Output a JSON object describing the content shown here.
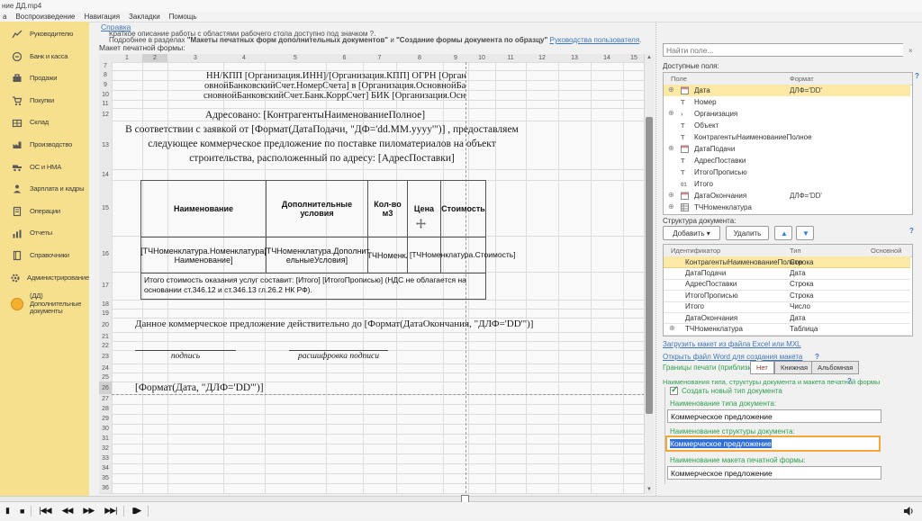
{
  "window": {
    "title": "ние ДД.mp4",
    "menus": [
      "а",
      "Воспроизведение",
      "Навигация",
      "Закладки",
      "Помощь"
    ]
  },
  "sidebar": {
    "items": [
      {
        "icon": "chart-icon",
        "label": "Руководителю"
      },
      {
        "icon": "bank-icon",
        "label": "Банк и касса"
      },
      {
        "icon": "sales-icon",
        "label": "Продажи"
      },
      {
        "icon": "cart-icon",
        "label": "Покупки"
      },
      {
        "icon": "warehouse-icon",
        "label": "Склад"
      },
      {
        "icon": "factory-icon",
        "label": "Производство"
      },
      {
        "icon": "assets-icon",
        "label": "ОС и НМА"
      },
      {
        "icon": "people-icon",
        "label": "Зарплата и кадры"
      },
      {
        "icon": "operations-icon",
        "label": "Операции"
      },
      {
        "icon": "reports-icon",
        "label": "Отчеты"
      },
      {
        "icon": "books-icon",
        "label": "Справочники"
      },
      {
        "icon": "gear-icon",
        "label": "Администрирование"
      },
      {
        "icon": "dd-icon",
        "label": "(ДД) Дополнительные документы"
      }
    ]
  },
  "help": {
    "link": "Справка",
    "line1": "Краткое описание работы с областями рабочего стола доступно под значком ?.",
    "line2_prefix": "Подробнее в разделах ",
    "line2_bold1": "\"Макеты печатных форм дополнительных документов\"",
    "line2_mid": " и ",
    "line2_bold2": "\"Создание формы документа по образцу\"",
    "line2_link": "Руководства пользователя",
    "line2_suffix": ".",
    "layout_label": "Макет печатной формы:"
  },
  "grid": {
    "col_numbers": [
      1,
      2,
      3,
      4,
      5,
      6,
      7,
      8,
      9,
      10,
      11,
      12,
      13,
      14,
      15
    ],
    "row_numbers": [
      7,
      8,
      9,
      10,
      11,
      12,
      13,
      14,
      15,
      16,
      17,
      18,
      19,
      20,
      21,
      22,
      23,
      24,
      25,
      26,
      27,
      28,
      29,
      30,
      31,
      32,
      33,
      34,
      35,
      36
    ],
    "selected_column": 2,
    "selected_row": 26
  },
  "template": {
    "row8": "НН/КПП [Организация.ИНН]/[Организация.КПП] ОГРН [Организация.ОГРН",
    "row9": "овнойБанковскийСчет.НомерСчета] в [Организация.ОсновнойБанковскийСч",
    "row10": "сновнойБанковскийСчет.Банк.КоррСчет] БИК [Организация.ОсновнойБанко",
    "row12": "Адресовано: [КонтрагентыНаименованиеПолное]",
    "row13": "В соответствии с заявкой от [Формат(ДатаПодачи, \"ДФ='dd.MM.yyyy'\")] , предоставляем\nследующее коммерческое предложение по поставке пиломатериалов на объект\nстроительства, расположенный по адресу: [АдресПоставки]",
    "table": {
      "headers": [
        "Наименование",
        "Дополнительные условия",
        "Кол-во м3",
        "Цена",
        "Стоимость"
      ],
      "row": [
        "[ТЧНоменклатура.Номенклатура.\nНаименование]",
        "[ТЧНоменклатура.Дополнит\nельныеУсловия]",
        "[ТЧНоменкл",
        "[ТЧНоменклатура.Стоимость]"
      ]
    },
    "totals": "Итого стоимость оказания услуг составит: [Итого] [ИтогоПрописью] (НДС не облагается на\nосновании ст.346.12 и ст.346.13 гл.26.2 НК РФ).",
    "row20": "Данное коммерческое предложение действительно до [Формат(ДатаОкончания, \"ДЛФ='DD'\")]",
    "sig1": "подпись",
    "sig2": "расшифровка подписи",
    "row26": "[Формат(Дата, \"ДЛФ='DD'\")]"
  },
  "fields_panel": {
    "search_placeholder": "Найти поле...",
    "clear_label": "×",
    "label": "Доступные поля:",
    "help_q": "?",
    "columns": [
      "Поле",
      "Формат"
    ],
    "rows": [
      {
        "name": "Дата",
        "icon": "calendar",
        "expand": true,
        "format": "ДЛФ='DD'",
        "selected": true
      },
      {
        "name": "Номер",
        "icon": "text"
      },
      {
        "name": "Организация",
        "icon": "ref",
        "expand": true
      },
      {
        "name": "Объект",
        "icon": "text"
      },
      {
        "name": "КонтрагентыНаименованиеПолное",
        "icon": "text"
      },
      {
        "name": "ДатаПодачи",
        "icon": "calendar",
        "expand": true
      },
      {
        "name": "АдресПоставки",
        "icon": "text"
      },
      {
        "name": "ИтогоПрописью",
        "icon": "text"
      },
      {
        "name": "Итого",
        "icon": "number"
      },
      {
        "name": "ДатаОкончания",
        "icon": "calendar",
        "expand": true,
        "format": "ДЛФ='DD'"
      },
      {
        "name": "ТЧНоменклатура",
        "icon": "table",
        "expand": true
      }
    ]
  },
  "structure_panel": {
    "label": "Структура документа:",
    "add_label": "Добавить",
    "add_arrow": "▾",
    "delete_label": "Удалить",
    "up_glyph": "▲",
    "down_glyph": "▼",
    "help_q": "?",
    "columns": [
      "Идентификатор",
      "Тип",
      "Основной"
    ],
    "rows": [
      {
        "id": "КонтрагентыНаименованиеПолное",
        "type": "Строка",
        "selected": true
      },
      {
        "id": "ДатаПодачи",
        "type": "Дата"
      },
      {
        "id": "АдресПоставки",
        "type": "Строка"
      },
      {
        "id": "ИтогоПрописью",
        "type": "Строка"
      },
      {
        "id": "Итого",
        "type": "Число"
      },
      {
        "id": "ДатаОкончания",
        "type": "Дата"
      },
      {
        "id": "ТЧНоменклатура",
        "type": "Таблица",
        "expand": true
      }
    ],
    "link_excel": "Загрузить макет из файла Excel или MXL",
    "link_word": "Открыть файл Word для создания макета",
    "word_q": "?"
  },
  "naming_panel": {
    "borders_label": "Границы печати (приблизительно):",
    "border_options": [
      "Нет",
      "Книжная",
      "Альбомная"
    ],
    "border_selected": "Нет",
    "heading": "Наименования типа, структуры документа и макета печатной формы",
    "heading_q": "?",
    "checkbox_label": "Создать новый тип документа",
    "checkbox_checked": true,
    "check_glyph": "✓",
    "fields": [
      {
        "label": "Наименование типа документа:",
        "value": "Коммерческое предложение"
      },
      {
        "label": "Наименование структуры документа:",
        "value": "Коммерческое предложение",
        "focused": true
      },
      {
        "label": "Наименование макета печатной формы:",
        "value": "Коммерческое предложение"
      }
    ]
  },
  "player": {
    "seek_percent": 50,
    "buttons": [
      {
        "glyph": "▮",
        "name": "pause-button"
      },
      {
        "glyph": "■",
        "name": "stop-button"
      },
      {
        "sep": true
      },
      {
        "glyph": "|◀◀",
        "name": "skip-back-button"
      },
      {
        "glyph": "◀◀",
        "name": "rewind-button"
      },
      {
        "glyph": "▶▶",
        "name": "fast-forward-button"
      },
      {
        "glyph": "▶▶|",
        "name": "skip-forward-button"
      },
      {
        "sep": true
      },
      {
        "glyph": "▮▶",
        "name": "frame-step-button"
      },
      {
        "sep": true
      }
    ]
  }
}
